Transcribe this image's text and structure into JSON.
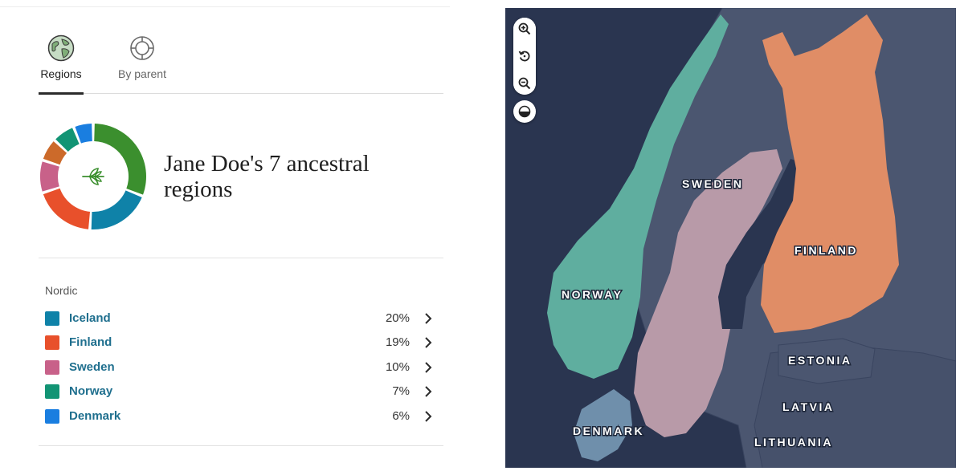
{
  "tabs": [
    {
      "label": "Regions",
      "icon": "globe-icon",
      "active": true
    },
    {
      "label": "By parent",
      "icon": "parent-ring-icon",
      "active": false
    }
  ],
  "summary": {
    "title": "Jane Doe's 7 ancestral regions",
    "center_icon": "leaf-icon"
  },
  "donut_segments": [
    {
      "color": "#3b8f2e",
      "percent": 31
    },
    {
      "color": "#0f82a8",
      "percent": 20
    },
    {
      "color": "#e8502b",
      "percent": 19
    },
    {
      "color": "#c86189",
      "percent": 10
    },
    {
      "color": "#cc6a2a",
      "percent": 7
    },
    {
      "color": "#129474",
      "percent": 7
    },
    {
      "color": "#1a7ee0",
      "percent": 6
    }
  ],
  "group": {
    "label": "Nordic"
  },
  "regions": [
    {
      "name": "Iceland",
      "percent": "20%",
      "color": "#0f82a8"
    },
    {
      "name": "Finland",
      "percent": "19%",
      "color": "#e8502b"
    },
    {
      "name": "Sweden",
      "percent": "10%",
      "color": "#c86189"
    },
    {
      "name": "Norway",
      "percent": "7%",
      "color": "#129474"
    },
    {
      "name": "Denmark",
      "percent": "6%",
      "color": "#1a7ee0"
    }
  ],
  "map": {
    "controls": [
      "zoom-in-icon",
      "reset-view-icon",
      "zoom-out-icon",
      "contrast-icon"
    ],
    "labels": {
      "sweden": "SWEDEN",
      "finland": "FINLAND",
      "norway": "NORWAY",
      "estonia": "ESTONIA",
      "latvia": "LATVIA",
      "denmark": "DENMARK",
      "lithuania": "LITHUANIA"
    },
    "colors": {
      "sea": "#2a3550",
      "land": "#4b5670",
      "norway": "#5fae9f",
      "sweden": "#b89aa8",
      "finland": "#e08d66",
      "denmark": "#6f8fab"
    }
  }
}
